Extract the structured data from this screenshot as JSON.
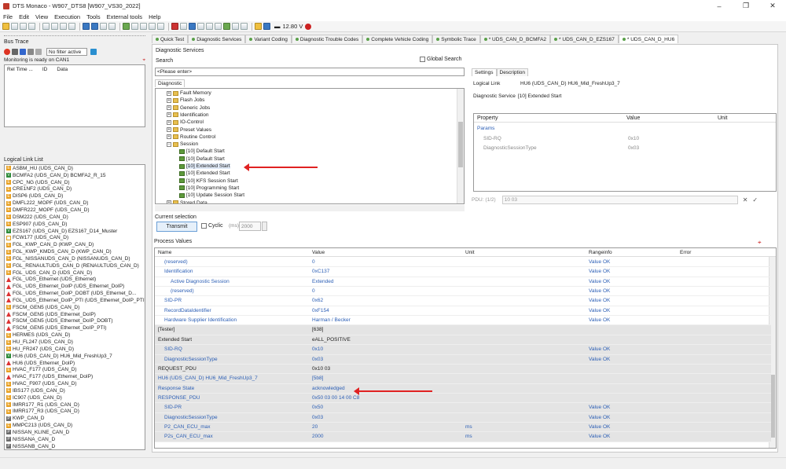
{
  "window": {
    "title": "DTS Monaco - W907_DTS8 [W907_VS30_2022]"
  },
  "menu": [
    "File",
    "Edit",
    "View",
    "Execution",
    "Tools",
    "External tools",
    "Help"
  ],
  "toolbar": {
    "voltage": "12.80 V"
  },
  "bus_trace": {
    "title": "Bus Trace",
    "filter": "No filter active",
    "status": "Monitoring is ready on CAN1",
    "columns": [
      "Rel Time ...",
      "ID",
      "Data"
    ]
  },
  "logical_link_list": {
    "title": "Logical Link List",
    "items": [
      {
        "badge": "E",
        "label": "ASBM_HU (UDS_CAN_D)"
      },
      {
        "badge": "V",
        "label": "BCMFA2 (UDS_CAN_D) BCMFA2_R_15"
      },
      {
        "badge": "E",
        "label": "CPC_NG (UDS_CAN_D)"
      },
      {
        "badge": "E",
        "label": "CRE1NF2 (UDS_CAN_D)"
      },
      {
        "badge": "E",
        "label": "DISP6 (UDS_CAN_D)"
      },
      {
        "badge": "E",
        "label": "DMFL222_MOPF (UDS_CAN_D)"
      },
      {
        "badge": "E",
        "label": "DMFR222_MOPF (UDS_CAN_D)"
      },
      {
        "badge": "E",
        "label": "DSM222 (UDS_CAN_D)"
      },
      {
        "badge": "E",
        "label": "ESP907 (UDS_CAN_D)"
      },
      {
        "badge": "V",
        "label": "EZS167 (UDS_CAN_D) EZS167_D14_Muster"
      },
      {
        "badge": "F",
        "label": "FCW177 (UDS_CAN_D)"
      },
      {
        "badge": "E",
        "label": "FGL_KWP_CAN_D (KWP_CAN_D)"
      },
      {
        "badge": "E",
        "label": "FGL_KWP_KMDS_CAN_D (KWP_CAN_D)"
      },
      {
        "badge": "E",
        "label": "FGL_NISSANUDS_CAN_D (NISSANUDS_CAN_D)"
      },
      {
        "badge": "E",
        "label": "FGL_RENAULTUDS_CAN_D (RENAULTUDS_CAN_D)"
      },
      {
        "badge": "E",
        "label": "FGL_UDS_CAN_D (UDS_CAN_D)"
      },
      {
        "badge": "W",
        "label": "FGL_UDS_Ethernet (UDS_Ethernet)"
      },
      {
        "badge": "W",
        "label": "FGL_UDS_Ethernet_DoIP (UDS_Ethernet_DoIP)"
      },
      {
        "badge": "W",
        "label": "FGL_UDS_Ethernet_DoIP_DOBT (UDS_Ethernet_D..."
      },
      {
        "badge": "W",
        "label": "FGL_UDS_Ethernet_DoIP_PTI (UDS_Ethernet_DoIP_PTI)"
      },
      {
        "badge": "E",
        "label": "FSCM_GEN5 (UDS_CAN_D)"
      },
      {
        "badge": "W",
        "label": "FSCM_GEN5 (UDS_Ethernet_DoIP)"
      },
      {
        "badge": "W",
        "label": "FSCM_GEN5 (UDS_Ethernet_DoIP_DOBT)"
      },
      {
        "badge": "W",
        "label": "FSCM_GEN5 (UDS_Ethernet_DoIP_PTI)"
      },
      {
        "badge": "E",
        "label": "HERMES (UDS_CAN_D)"
      },
      {
        "badge": "E",
        "label": "HU_FL247 (UDS_CAN_D)"
      },
      {
        "badge": "E",
        "label": "HU_FR247 (UDS_CAN_D)"
      },
      {
        "badge": "V",
        "label": "HU6 (UDS_CAN_D) HU6_Mid_FreshUp3_7"
      },
      {
        "badge": "W",
        "label": "HU6 (UDS_Ethernet_DoIP)"
      },
      {
        "badge": "E",
        "label": "HVAC_F177 (UDS_CAN_D)"
      },
      {
        "badge": "W",
        "label": "HVAC_F177 (UDS_Ethernet_DoIP)"
      },
      {
        "badge": "E",
        "label": "HVAC_F907 (UDS_CAN_D)"
      },
      {
        "badge": "E",
        "label": "IBS177 (UDS_CAN_D)"
      },
      {
        "badge": "E",
        "label": "IC907 (UDS_CAN_D)"
      },
      {
        "badge": "E",
        "label": "IMRR177_R1 (UDS_CAN_D)"
      },
      {
        "badge": "E",
        "label": "IMRR177_R3 (UDS_CAN_D)"
      },
      {
        "badge": "P",
        "label": "KWP_CAN_D"
      },
      {
        "badge": "E",
        "label": "MMPC213 (UDS_CAN_D)"
      },
      {
        "badge": "P",
        "label": "NISSAN_KLINE_CAN_D"
      },
      {
        "badge": "P",
        "label": "NISSANA_CAN_D"
      },
      {
        "badge": "P",
        "label": "NISSANB_CAN_D"
      }
    ]
  },
  "tabs": [
    {
      "label": "Quick Test"
    },
    {
      "label": "Diagnostic Services"
    },
    {
      "label": "Variant Coding"
    },
    {
      "label": "Diagnostic Trouble Codes"
    },
    {
      "label": "Complete Vehicle Coding"
    },
    {
      "label": "Symbolic Trace"
    },
    {
      "label": "* UDS_CAN_D_BCMFA2"
    },
    {
      "label": "* UDS_CAN_D_EZS167"
    },
    {
      "label": "* UDS_CAN_D_HU6"
    }
  ],
  "diag_services": {
    "title": "Diagnostic Services",
    "search_label": "Search",
    "search_placeholder": "<Please enter>",
    "global_search": "Global Search",
    "tree_tab": "Diagnostic",
    "tree": [
      {
        "label": "Fault Memory",
        "type": "folder",
        "level": 0
      },
      {
        "label": "Flash Jobs",
        "type": "folder",
        "level": 0
      },
      {
        "label": "Generic Jobs",
        "type": "folder",
        "level": 0
      },
      {
        "label": "Identification",
        "type": "folder",
        "level": 0
      },
      {
        "label": "IO-Control",
        "type": "folder",
        "level": 0
      },
      {
        "label": "Preset Values",
        "type": "folder",
        "level": 0
      },
      {
        "label": "Routine Control",
        "type": "folder",
        "level": 0
      },
      {
        "label": "Session",
        "type": "folder",
        "level": 0
      },
      {
        "label": "[10] Default Start",
        "type": "svc",
        "level": 1
      },
      {
        "label": "[10] Default Start",
        "type": "svc",
        "level": 1
      },
      {
        "label": "[10] Extended Start",
        "type": "svc",
        "level": 1
      },
      {
        "label": "[10] Extended Start",
        "type": "svc",
        "level": 1
      },
      {
        "label": "[10] KFS Session Start",
        "type": "svc",
        "level": 1
      },
      {
        "label": "[10] Programming Start",
        "type": "svc",
        "level": 1
      },
      {
        "label": "[10] Update Session Start",
        "type": "svc",
        "level": 1
      },
      {
        "label": "Stored Data",
        "type": "folder",
        "level": 0
      }
    ],
    "current_selection": "Current selection",
    "transmit": "Transmit",
    "cyclic": "Cyclic",
    "ms_label": "(ms)",
    "ms_value": "2000"
  },
  "settings": {
    "tabs": [
      "Settings",
      "Description"
    ],
    "logical_link_label": "Logical Link",
    "logical_link_value": "HU6 (UDS_CAN_D) HU6_Mid_FreshUp3_7",
    "diag_service_label": "Diagnostic Service",
    "diag_service_value": "[10] Extended Start",
    "columns": [
      "Property",
      "Value",
      "Unit"
    ],
    "params_label": "Params",
    "rows": [
      {
        "property": "SID-RQ",
        "value": "0x10"
      },
      {
        "property": "DiagnosticSessionType",
        "value": "0x03"
      }
    ],
    "pdu_label": "PDU: (1/2)",
    "pdu_value": "10 03"
  },
  "process_values": {
    "title": "Process Values",
    "columns": [
      "Name",
      "Value",
      "Unit",
      "Rangeinfo",
      "Error"
    ],
    "rows": [
      {
        "name": "(reserved)",
        "value": "0",
        "unit": "",
        "range": "Value OK",
        "indent": 1,
        "grey": false
      },
      {
        "name": "Identification",
        "value": "0xC137",
        "unit": "",
        "range": "Value OK",
        "indent": 1,
        "grey": false
      },
      {
        "name": "Active Diagnostic Session",
        "value": "Extended",
        "unit": "",
        "range": "Value OK",
        "indent": 2,
        "grey": false
      },
      {
        "name": "(reserved)",
        "value": "0",
        "unit": "",
        "range": "Value OK",
        "indent": 2,
        "grey": false
      },
      {
        "name": "SID-PR",
        "value": "0x62",
        "unit": "",
        "range": "Value OK",
        "indent": 1,
        "grey": false
      },
      {
        "name": "RecordDataIdentifier",
        "value": "0xF154",
        "unit": "",
        "range": "Value OK",
        "indent": 1,
        "grey": false
      },
      {
        "name": "Hardware Supplier Identification",
        "value": "Harman / Becker",
        "unit": "",
        "range": "Value OK",
        "indent": 1,
        "grey": false
      },
      {
        "name": "[Tester]",
        "value": "[638]",
        "unit": "",
        "range": "",
        "indent": 0,
        "grey": true
      },
      {
        "name": "Extended Start",
        "value": "eALL_POSITIVE",
        "unit": "",
        "range": "",
        "indent": 0,
        "grey": true
      },
      {
        "name": "SID-RQ",
        "value": "0x10",
        "unit": "",
        "range": "Value OK",
        "indent": 1,
        "grey": true
      },
      {
        "name": "DiagnosticSessionType",
        "value": "0x03",
        "unit": "",
        "range": "Value OK",
        "indent": 1,
        "grey": true
      },
      {
        "name": "REQUEST_PDU",
        "value": "0x10 03",
        "unit": "",
        "range": "",
        "indent": 0,
        "grey": true
      },
      {
        "name": "HU6 (UDS_CAN_D) HU6_Mid_FreshUp3_7",
        "value": "[5b8]",
        "unit": "",
        "range": "",
        "indent": 0,
        "grey": true
      },
      {
        "name": "Response State",
        "value": "acknowledged",
        "unit": "",
        "range": "",
        "indent": 0,
        "grey": true
      },
      {
        "name": "RESPONSE_PDU",
        "value": "0x50 03 00 14 00 C8",
        "unit": "",
        "range": "",
        "indent": 0,
        "grey": true
      },
      {
        "name": "SID-PR",
        "value": "0x50",
        "unit": "",
        "range": "Value OK",
        "indent": 1,
        "grey": true
      },
      {
        "name": "DiagnosticSessionType",
        "value": "0x03",
        "unit": "",
        "range": "Value OK",
        "indent": 1,
        "grey": true
      },
      {
        "name": "P2_CAN_ECU_max",
        "value": "20",
        "unit": "ms",
        "range": "Value OK",
        "indent": 1,
        "grey": true
      },
      {
        "name": "P2s_CAN_ECU_max",
        "value": "2000",
        "unit": "ms",
        "range": "Value OK",
        "indent": 1,
        "grey": true
      }
    ]
  }
}
